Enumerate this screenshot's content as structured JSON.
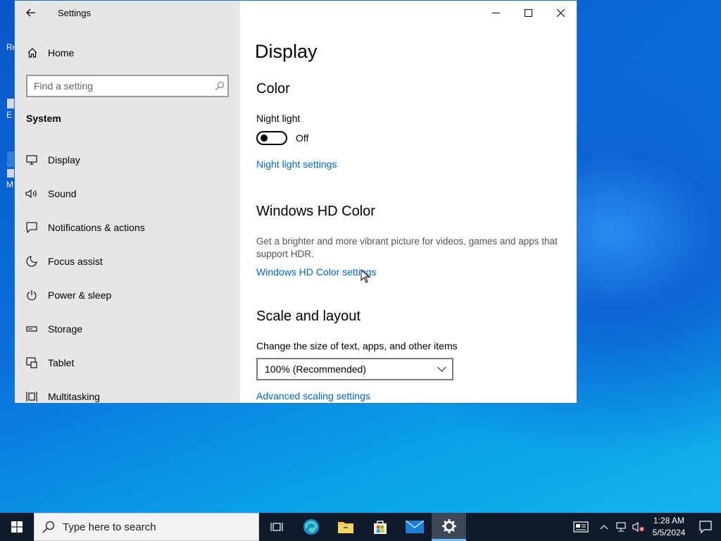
{
  "window": {
    "title": "Settings",
    "controls": [
      "minimize-icon",
      "maximize-icon",
      "close-icon"
    ]
  },
  "sidebar": {
    "home_label": "Home",
    "search_placeholder": "Find a setting",
    "section_label": "System",
    "items": [
      {
        "label": "Display",
        "icon": "display-icon"
      },
      {
        "label": "Sound",
        "icon": "sound-icon"
      },
      {
        "label": "Notifications & actions",
        "icon": "notifications-icon"
      },
      {
        "label": "Focus assist",
        "icon": "moon-icon"
      },
      {
        "label": "Power & sleep",
        "icon": "power-icon"
      },
      {
        "label": "Storage",
        "icon": "storage-icon"
      },
      {
        "label": "Tablet",
        "icon": "tablet-icon"
      },
      {
        "label": "Multitasking",
        "icon": "multitasking-icon"
      }
    ]
  },
  "content": {
    "title": "Display",
    "color_heading": "Color",
    "night_light_label": "Night light",
    "night_light_state": "Off",
    "night_light_settings_link": "Night light settings",
    "hd_heading": "Windows HD Color",
    "hd_description": "Get a brighter and more vibrant picture for videos, games and apps that support HDR.",
    "hd_settings_link": "Windows HD Color settings",
    "scale_heading": "Scale and layout",
    "scale_label": "Change the size of text, apps, and other items",
    "scale_value": "100% (Recommended)",
    "advanced_scaling_link": "Advanced scaling settings"
  },
  "taskbar": {
    "search_placeholder": "Type here to search",
    "time": "1:28 AM",
    "date": "5/5/2024"
  },
  "colors": {
    "accent_link": "#0067c0",
    "sidebar_bg": "#e6e6e6",
    "taskbar_bg": "#0f1a2a"
  }
}
